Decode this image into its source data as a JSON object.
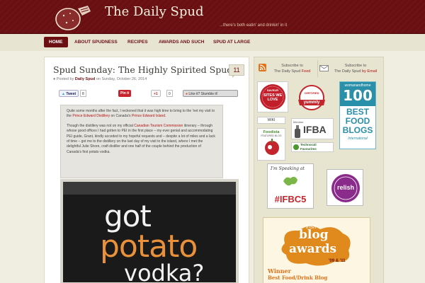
{
  "header": {
    "title": "The Daily Spud",
    "tagline": "...there's both eatin' and drinkin' in it"
  },
  "nav": {
    "items": [
      "HOME",
      "ABOUT SPUDNESS",
      "RECIPES",
      "AWARDS AND SUCH",
      "SPUD AT LARGE"
    ],
    "active": "HOME"
  },
  "post": {
    "title": "Spud Sunday: The Highly Spirited Spud",
    "comment_count": "11",
    "byline": {
      "prefix": "Posted by",
      "author": "Daily Spud",
      "date_text": "on Sunday, October 26, 2014"
    },
    "share": {
      "tweet": "Tweet",
      "tweet_count": "8",
      "pin": "Pin it",
      "gplus": "+1",
      "gplus_count": "0",
      "stumble": "Like it? Stumble it!"
    },
    "excerpt": {
      "p1_a": "Quite some months after the fact, I reckoned that it was high time to bring to the  'net my visit to the ",
      "p1_link1": "Prince Edward Distillery",
      "p1_b": " on Canada's ",
      "p1_link2": "Prince Edward Island",
      "p1_c": ".",
      "p2_a": "Though the distillery was not on my official ",
      "p2_link": "Canadian Tourism Commission",
      "p2_b": " itinerary – through whose good offices I had gotten to PEI in the first place – my ever genial and accommodating PEI guide, Grant, kindly acceded to my hopeful requests and – despite a lot of miles and a lack of time – got me to the distillery on the last day of my visit to the island, where I met the delightful Julie Shore, craft distiller and one half of the couple behind the production of Canada's first potato vodka."
    },
    "photo_text": {
      "line1": "got",
      "line2": "potato",
      "line3": "vodka?"
    }
  },
  "sidebar": {
    "subscribe_feed": {
      "line1": "Subscribe to",
      "line2_plain": "The Daily Spud ",
      "line2_link": "Feed"
    },
    "subscribe_email": {
      "line1": "Subscribe to",
      "line2_plain": "The Daily Spud ",
      "line2_link": "by Email"
    },
    "badges": {
      "saveur_top": "SAVEUR",
      "saveur_main": "SITES WE LOVE",
      "yummly": "yummly",
      "yummly_sub": "CERTIFIED",
      "wah_brand": "womanandhome",
      "wah_num": "100",
      "wah_line1": "BEST",
      "wah_line2": "FOOD",
      "wah_line3": "BLOGS",
      "wah_sub": "International",
      "wiki": "WIKI",
      "foodista": "Foodista",
      "foodista_sub": "FEATURED BLOG",
      "ifba": "IFBA",
      "ifba_sub": "Member",
      "technorati": "Technorati Favourites",
      "speaking": "I'm Speaking at",
      "ifbc": "#IFBC5",
      "relish": "relish",
      "blog_awards_top": "irish",
      "blog_awards_1": "blog",
      "blog_awards_2": "awards",
      "blog_awards_years": "'09 & '11",
      "blog_awards_winner": "Winner",
      "blog_awards_cat": "Best Food/Drink Blog"
    }
  },
  "colors": {
    "header_bg": "#6b0f12",
    "accent_link": "#b01515",
    "page_bg": "#efeee0"
  }
}
